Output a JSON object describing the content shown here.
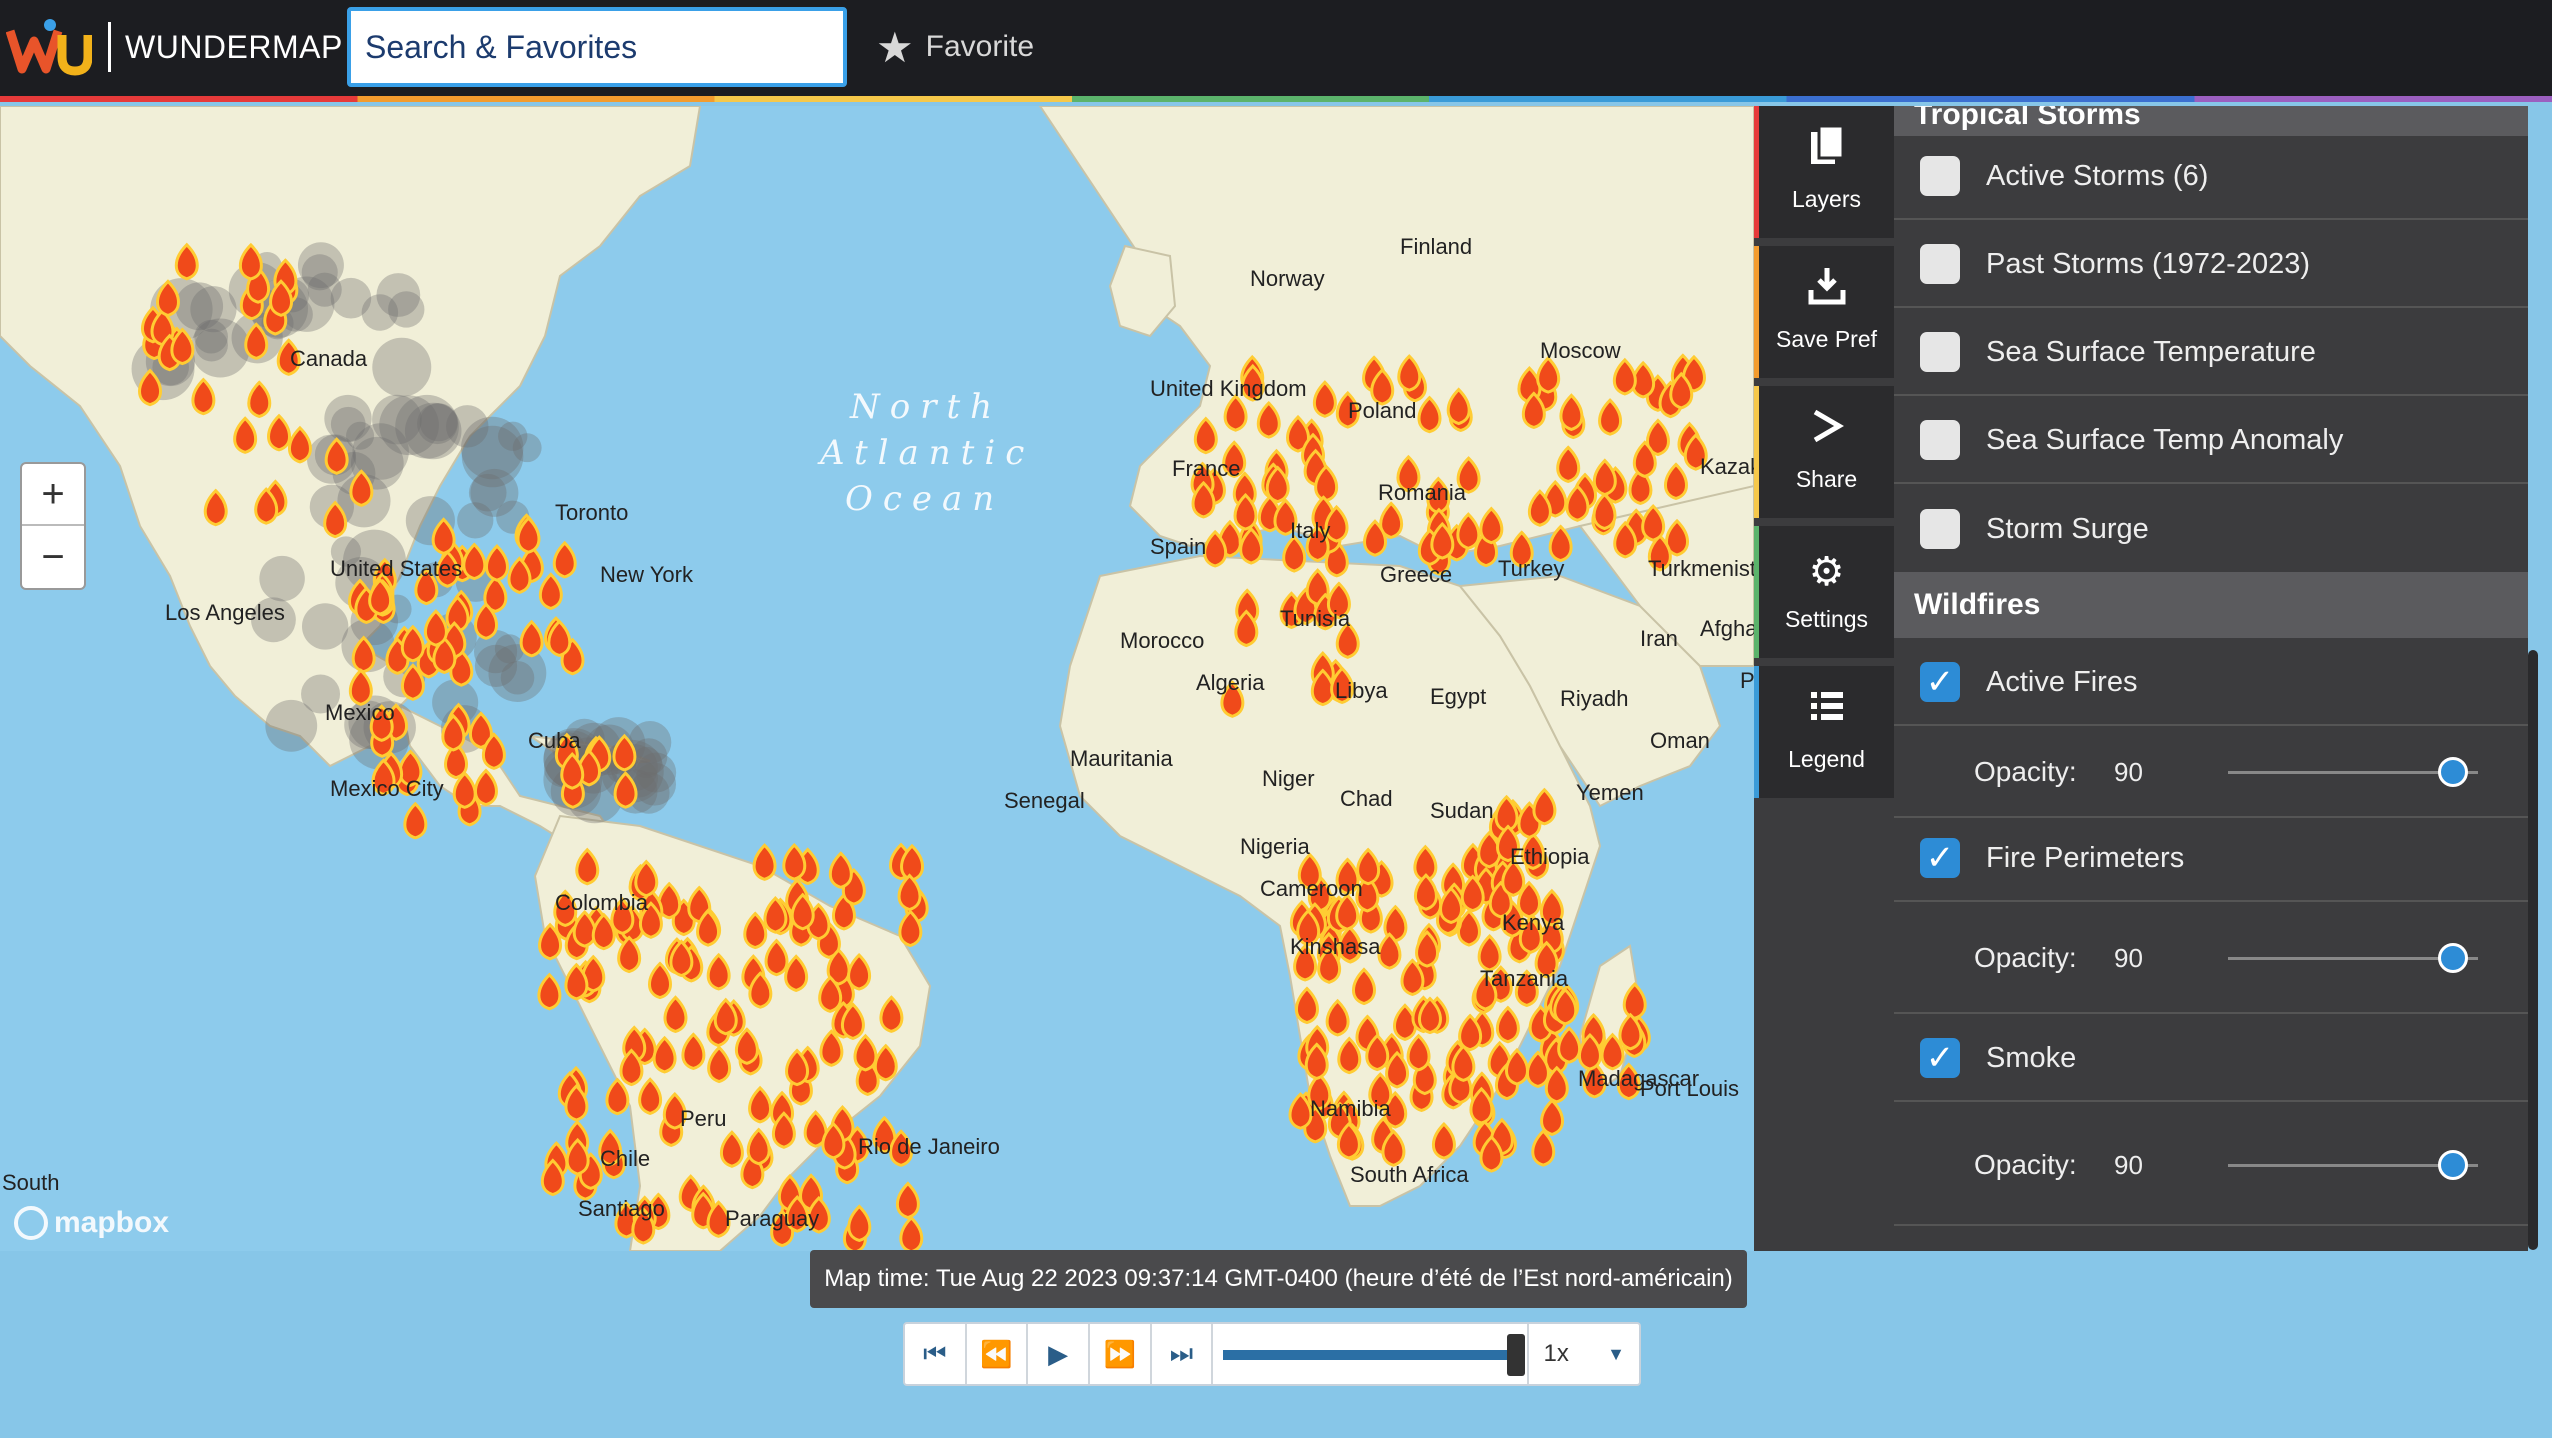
{
  "header": {
    "brand": "WUNDERMAP",
    "search_placeholder": "Search & Favorites",
    "favorite_label": "Favorite"
  },
  "map": {
    "zoom_in": "+",
    "zoom_out": "−",
    "attribution": "mapbox",
    "ocean_labels": [
      "North",
      "Atlantic",
      "Ocean"
    ],
    "cities": [
      "Norway",
      "Finland",
      "United Kingdom",
      "Poland",
      "Moscow",
      "Kazakhstan",
      "France",
      "Romania",
      "Spain",
      "Italy",
      "Greece",
      "Turkey",
      "Turkmenistan",
      "Afghanistan",
      "Morocco",
      "Tunisia",
      "Algeria",
      "Libya",
      "Egypt",
      "Iran",
      "Riyadh",
      "Oman",
      "Pakistan",
      "Mauritania",
      "Niger",
      "Chad",
      "Sudan",
      "Yemen",
      "Senegal",
      "Nigeria",
      "Ethiopia",
      "Cameroon",
      "Kenya",
      "Kinshasa",
      "Tanzania",
      "Namibia",
      "South Africa",
      "Madagascar",
      "Port Louis",
      "Toronto",
      "New York",
      "Los Angeles",
      "United States",
      "Canada",
      "Mexico",
      "Mexico City",
      "Cuba",
      "Colombia",
      "Peru",
      "Chile",
      "Santiago",
      "Paraguay",
      "Rio de Janeiro",
      "South",
      "Ocean"
    ]
  },
  "toolbar": [
    {
      "label": "Layers",
      "icon": "layers-icon"
    },
    {
      "label": "Save Pref",
      "icon": "download-icon"
    },
    {
      "label": "Share",
      "icon": "share-icon"
    },
    {
      "label": "Settings",
      "icon": "gear-icon"
    },
    {
      "label": "Legend",
      "icon": "list-icon"
    }
  ],
  "panel": {
    "cut_header": "Tropical Storms",
    "storms": [
      {
        "label": "Active Storms (6)",
        "checked": false
      },
      {
        "label": "Past Storms (1972-2023)",
        "checked": false
      },
      {
        "label": "Sea Surface Temperature",
        "checked": false
      },
      {
        "label": "Sea Surface Temp Anomaly",
        "checked": false
      },
      {
        "label": "Storm Surge",
        "checked": false
      }
    ],
    "wildfires_title": "Wildfires",
    "wildfires": [
      {
        "label": "Active Fires",
        "checked": true,
        "opacity_label": "Opacity:",
        "opacity": "90"
      },
      {
        "label": "Fire Perimeters",
        "checked": true,
        "opacity_label": "Opacity:",
        "opacity": "90"
      },
      {
        "label": "Smoke",
        "checked": true,
        "opacity_label": "Opacity:",
        "opacity": "90"
      }
    ]
  },
  "timeline": {
    "map_time": "Map time: Tue Aug 22 2023 09:37:14 GMT-0400 (heure d’été de l’Est nord-américain)",
    "progress": 1.0,
    "speed": "1x"
  },
  "colors": {
    "accent": "#2d8cd6",
    "header_bg": "#1c1d21",
    "panel_bg": "#3c3c3e",
    "ocean": "#8dcbec",
    "land": "#f1efd8",
    "fire": "#f04a1a"
  }
}
